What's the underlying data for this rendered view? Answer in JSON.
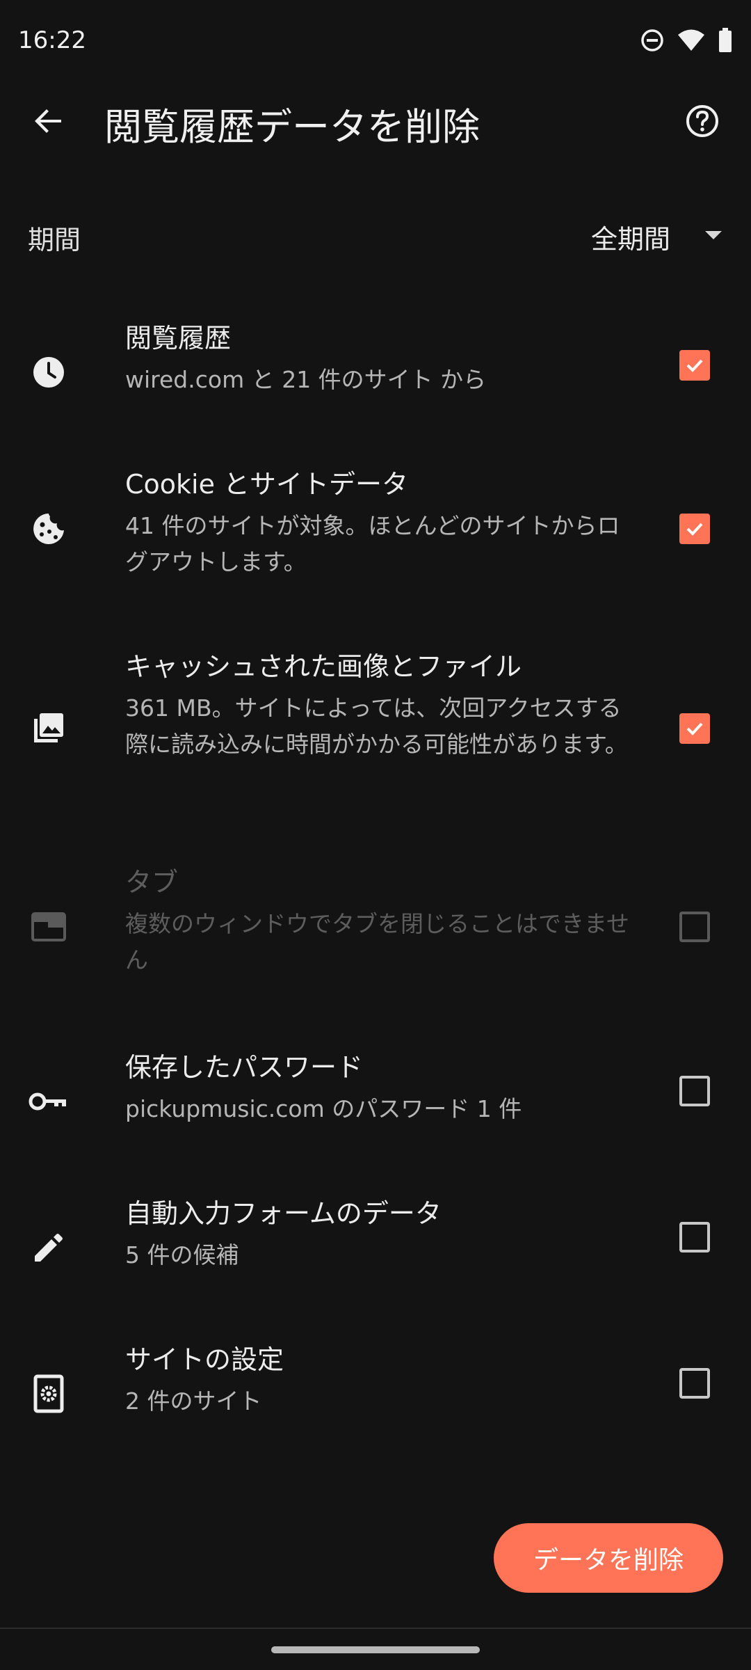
{
  "status_bar": {
    "time": "16:22",
    "icons": [
      "do-not-disturb-icon",
      "wifi-icon",
      "battery-icon"
    ]
  },
  "app_bar": {
    "title": "閲覧履歴データを削除",
    "back_icon": "back-arrow-icon",
    "help_icon": "help-icon"
  },
  "period": {
    "label": "期間",
    "value": "全期間"
  },
  "items": [
    {
      "title": "閲覧履歴",
      "desc": "wired.com と 21 件のサイト から",
      "icon": "clock-icon",
      "checked": true,
      "enabled": true
    },
    {
      "title": "Cookie とサイトデータ",
      "desc": "41 件のサイトが対象。ほとんどのサイトからログアウトします。",
      "icon": "cookie-icon",
      "checked": true,
      "enabled": true
    },
    {
      "title": "キャッシュされた画像とファイル",
      "desc": "361 MB。サイトによっては、次回アクセスする際に読み込みに時間がかかる可能性があります。",
      "icon": "images-icon",
      "checked": true,
      "enabled": true
    },
    {
      "title": "タブ",
      "desc": "複数のウィンドウでタブを閉じることはできません",
      "icon": "tab-icon",
      "checked": false,
      "enabled": false
    },
    {
      "title": "保存したパスワード",
      "desc": "pickupmusic.com のパスワード 1 件",
      "icon": "key-icon",
      "checked": false,
      "enabled": true
    },
    {
      "title": "自動入力フォームのデータ",
      "desc": "5 件の候補",
      "icon": "pencil-icon",
      "checked": false,
      "enabled": true
    },
    {
      "title": "サイトの設定",
      "desc": "2 件のサイト",
      "icon": "site-settings-icon",
      "checked": false,
      "enabled": true
    }
  ],
  "delete_button": {
    "label": "データを削除"
  },
  "colors": {
    "background": "#131313",
    "accent": "#ff7356",
    "text_primary": "#ececec",
    "text_secondary": "#b6b6b6",
    "text_disabled": "#5d5d5d"
  }
}
